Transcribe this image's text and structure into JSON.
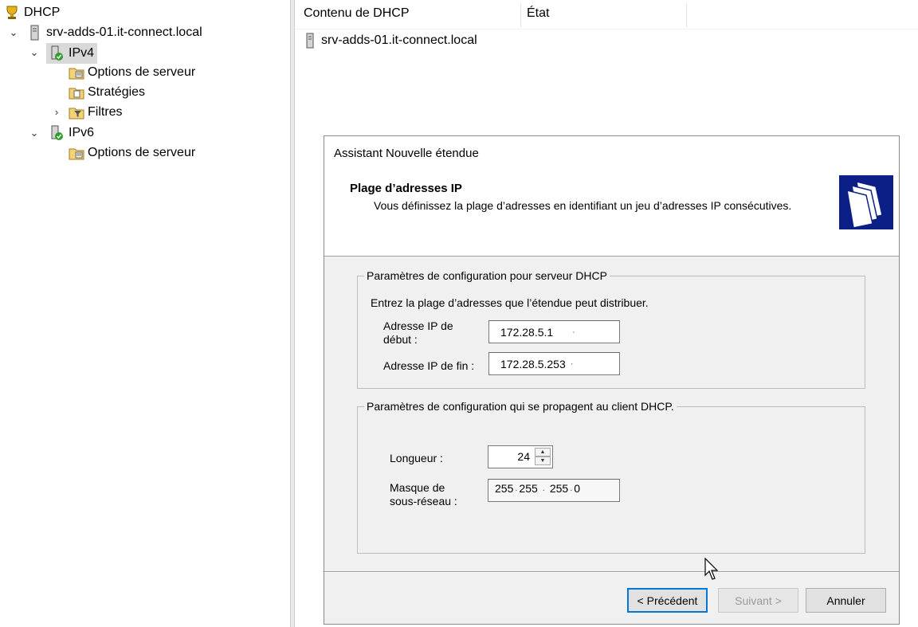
{
  "tree": {
    "root": "DHCP",
    "server": "srv-adds-01.it-connect.local",
    "ipv4": "IPv4",
    "ipv4_children": [
      "Options de serveur",
      "Stratégies",
      "Filtres"
    ],
    "ipv6": "IPv6",
    "ipv6_children": [
      "Options de serveur"
    ]
  },
  "content": {
    "columns": [
      "Contenu de DHCP",
      "État"
    ],
    "rows": [
      "srv-adds-01.it-connect.local"
    ]
  },
  "wizard": {
    "window_title": "Assistant Nouvelle étendue",
    "heading": "Plage d’adresses IP",
    "subheading": "Vous définissez la plage d’adresses en identifiant un jeu d’adresses IP consécutives.",
    "group1": {
      "legend": "Paramètres de configuration pour serveur DHCP",
      "instruction": "Entrez la plage d’adresses que l’étendue peut distribuer.",
      "start_label_1": "Adresse IP de",
      "start_label_2": "début :",
      "start_value": "172.28.5.1",
      "end_label": "Adresse IP de fin :",
      "end_value": "172.28.5.253"
    },
    "group2": {
      "legend": "Paramètres de configuration qui se propagent au client DHCP.",
      "length_label": "Longueur :",
      "length_value": "24",
      "mask_label_1": "Masque de",
      "mask_label_2": "sous-réseau :",
      "mask_octets": [
        "255",
        "255",
        "255",
        "0"
      ]
    },
    "buttons": {
      "back": "< Précédent",
      "next": "Suivant >",
      "cancel": "Annuler"
    }
  }
}
